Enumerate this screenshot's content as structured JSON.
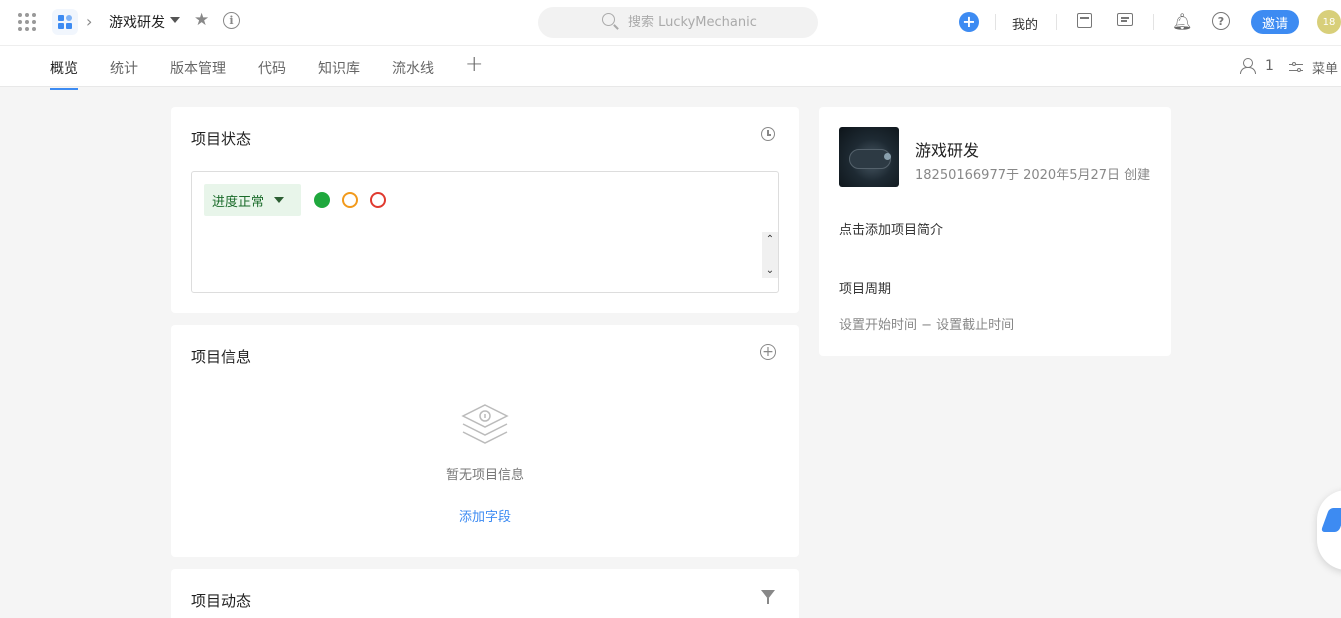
{
  "topbar": {
    "project_name": "游戏研发",
    "search_placeholder": "搜索 LuckyMechanic",
    "mine_label": "我的",
    "invite_label": "邀请",
    "avatar_text": "18",
    "accent_color": "#3d8bf2"
  },
  "nav": {
    "tabs": [
      {
        "label": "概览",
        "active": true
      },
      {
        "label": "统计",
        "active": false
      },
      {
        "label": "版本管理",
        "active": false
      },
      {
        "label": "代码",
        "active": false
      },
      {
        "label": "知识库",
        "active": false
      },
      {
        "label": "流水线",
        "active": false
      }
    ],
    "member_count": "1",
    "menu_label": "菜单"
  },
  "status_card": {
    "title": "项目状态",
    "status_value": "进度正常",
    "status_colors": [
      "#1fa83d",
      "#f29a1c",
      "#e03a2f"
    ]
  },
  "info_card": {
    "title": "项目信息",
    "empty_text": "暂无项目信息",
    "add_field_label": "添加字段"
  },
  "activity_card": {
    "title": "项目动态"
  },
  "project_card": {
    "name": "游戏研发",
    "created_by": "18250166977于 2020年5月27日 创建",
    "intro_placeholder": "点击添加项目简介",
    "period_label": "项目周期",
    "period_value": "设置开始时间  −  设置截止时间"
  }
}
